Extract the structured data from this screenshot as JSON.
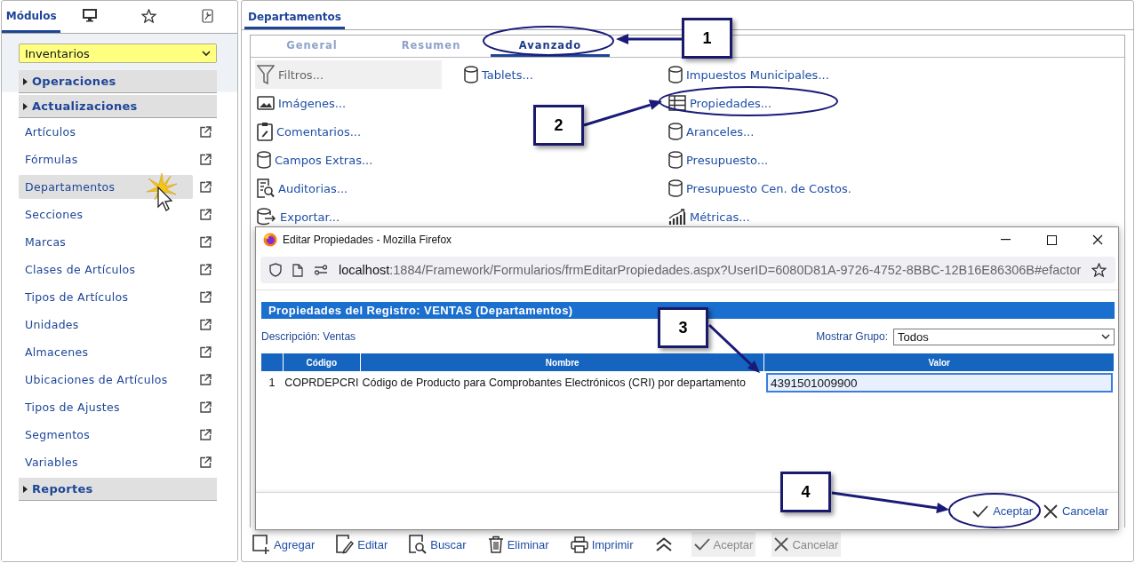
{
  "sidebar": {
    "tabs": [
      {
        "kind": "text",
        "label": "Módulos",
        "selected": true
      },
      {
        "kind": "monitor",
        "selected": false
      },
      {
        "kind": "star",
        "selected": false
      },
      {
        "kind": "tool",
        "selected": false
      }
    ],
    "module_select": {
      "value": "Inventarios"
    },
    "sections": [
      {
        "label": "Operaciones"
      },
      {
        "label": "Actualizaciones",
        "items": [
          {
            "label": "Artículos",
            "selected": false
          },
          {
            "label": "Fórmulas",
            "selected": false
          },
          {
            "label": "Departamentos",
            "selected": true
          },
          {
            "label": "Secciones",
            "selected": false
          },
          {
            "label": "Marcas",
            "selected": false
          },
          {
            "label": "Clases de Artículos",
            "selected": false
          },
          {
            "label": "Tipos de Artículos",
            "selected": false
          },
          {
            "label": "Unidades",
            "selected": false
          },
          {
            "label": "Almacenes",
            "selected": false
          },
          {
            "label": "Ubicaciones de Artículos",
            "selected": false
          },
          {
            "label": "Tipos de Ajustes",
            "selected": false
          },
          {
            "label": "Segmentos",
            "selected": false
          },
          {
            "label": "Variables",
            "selected": false
          }
        ]
      },
      {
        "label": "Reportes"
      }
    ]
  },
  "main": {
    "tab": {
      "label": "Departamentos",
      "selected": true
    },
    "subtabs": [
      {
        "label": "General",
        "selected": false
      },
      {
        "label": "Resumen",
        "selected": false
      },
      {
        "label": "Avanzado",
        "selected": true
      }
    ],
    "link_columns": [
      {
        "links": [
          {
            "kind": "filter",
            "label": "Filtros...",
            "disabled": true
          },
          {
            "kind": "image",
            "label": "Imágenes...",
            "disabled": false
          },
          {
            "kind": "clipboard",
            "label": "Comentarios...",
            "disabled": false
          },
          {
            "kind": "database",
            "label": "Campos Extras...",
            "disabled": false
          },
          {
            "kind": "audit",
            "label": "Auditorias...",
            "disabled": false
          },
          {
            "kind": "export",
            "label": "Exportar...",
            "disabled": false
          }
        ]
      },
      {
        "links": [
          {
            "kind": "database",
            "label": "Tablets...",
            "disabled": false
          }
        ]
      },
      {
        "links": [
          {
            "kind": "database",
            "label": "Impuestos Municipales...",
            "disabled": false
          },
          {
            "kind": "grid",
            "label": "Propiedades...",
            "disabled": false
          },
          {
            "kind": "database",
            "label": "Aranceles...",
            "disabled": false
          },
          {
            "kind": "database",
            "label": "Presupuesto...",
            "disabled": false
          },
          {
            "kind": "database",
            "label": "Presupuesto Cen. de Costos.",
            "disabled": false
          },
          {
            "kind": "chart",
            "label": "Métricas...",
            "disabled": false
          }
        ]
      }
    ],
    "toolbar": [
      {
        "kind": "add",
        "label": "Agregar",
        "disabled": false
      },
      {
        "kind": "edit",
        "label": "Editar",
        "disabled": false
      },
      {
        "kind": "search",
        "label": "Buscar",
        "disabled": false
      },
      {
        "kind": "delete",
        "label": "Eliminar",
        "disabled": false
      },
      {
        "kind": "print",
        "label": "Imprimir",
        "disabled": false
      },
      {
        "kind": "collapse",
        "disabled": false
      },
      {
        "kind": "accept",
        "label": "Aceptar",
        "disabled": true
      },
      {
        "kind": "cancel",
        "label": "Cancelar",
        "disabled": true
      }
    ]
  },
  "popup": {
    "title": "Editar Propiedades - Mozilla Firefox",
    "url_host": "localhost",
    "url_path": ":1884/Framework/Formularios/frmEditarPropiedades.aspx?UserID=6080D81A-9726-4752-8BBC-12B16E86306B#efactor",
    "header": "Propiedades del Registro: VENTAS (Departamentos)",
    "description": "Descripción: Ventas",
    "group_label": "Mostrar Grupo:",
    "group_value": "Todos",
    "columns": [
      "Código",
      "Nombre",
      "Valor"
    ],
    "rows": [
      {
        "index": "1",
        "code": "COPRDEPCRI",
        "name": "Código de Producto para Comprobantes Electrónicos (CRI) por departamento",
        "value": "4391501009900"
      }
    ],
    "buttons": [
      {
        "kind": "accept",
        "label": "Aceptar",
        "disabled": false
      },
      {
        "kind": "cancel",
        "label": "Cancelar",
        "disabled": false
      }
    ]
  },
  "callouts": [
    {
      "label": "1"
    },
    {
      "label": "2"
    },
    {
      "label": "3"
    },
    {
      "label": "4"
    }
  ]
}
